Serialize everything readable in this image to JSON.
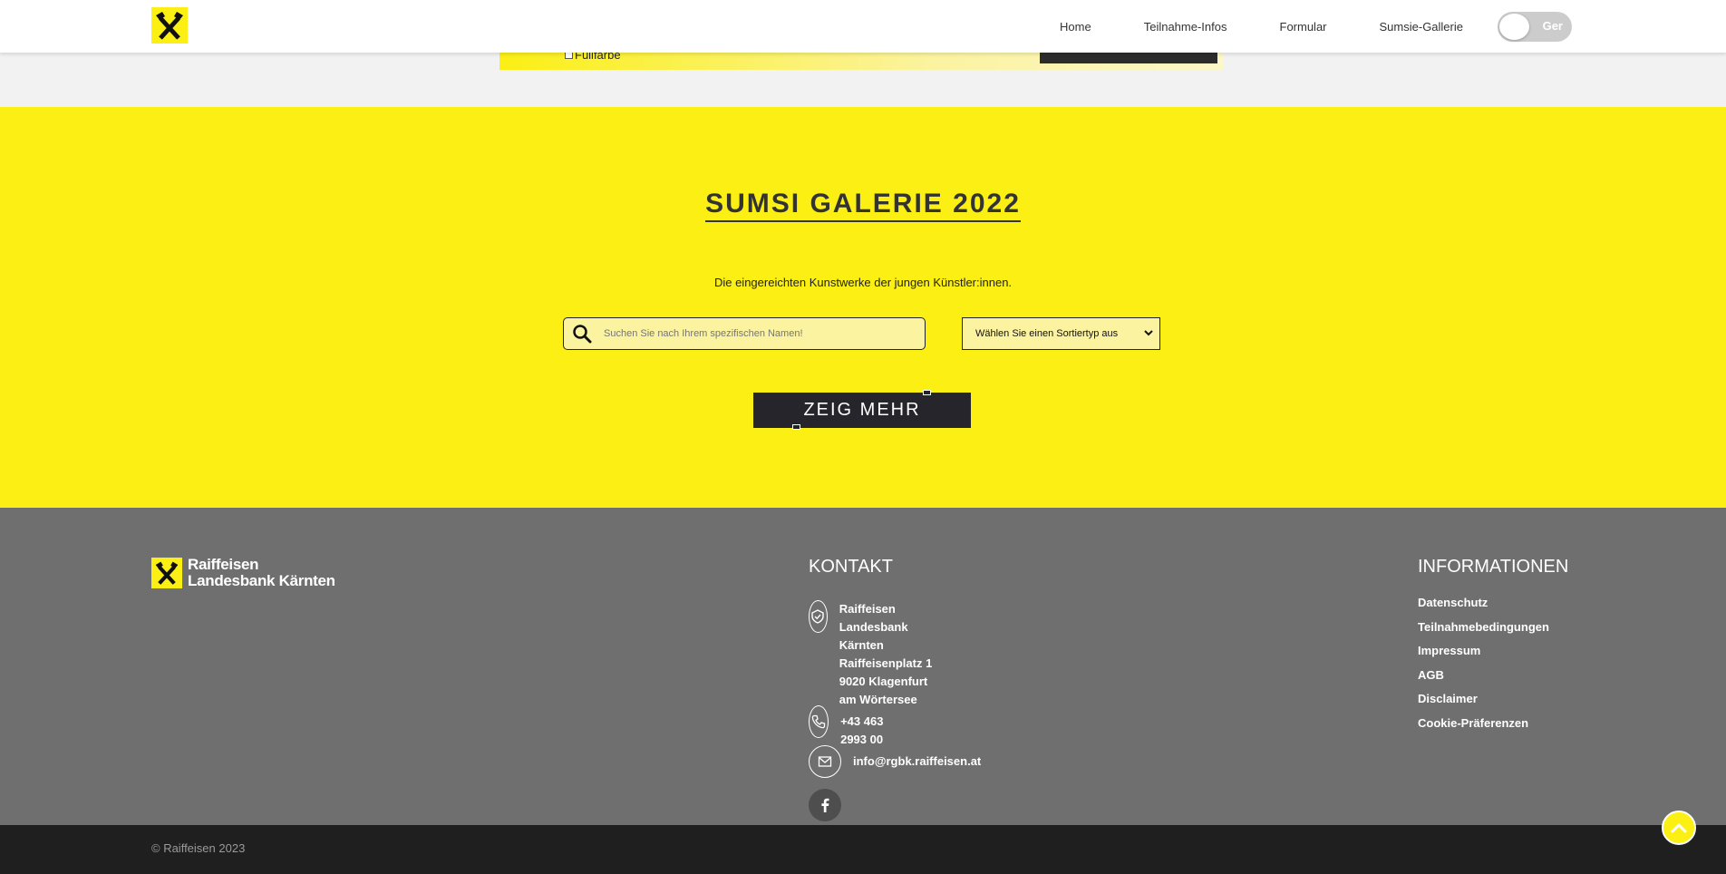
{
  "nav": {
    "items": [
      "Home",
      "Teilnahme-Infos",
      "Formular",
      "Sumsie-Gallerie"
    ],
    "language_toggle": "Ger"
  },
  "form_strip": {
    "checkbox_label": "Füllfarbe"
  },
  "gallery": {
    "title": "SUMSI GALERIE 2022",
    "subtitle": "Die eingereichten Kunstwerke der jungen Künstler:innen.",
    "search_placeholder": "Suchen Sie nach Ihrem spezifischen Namen!",
    "sort_selected": "Wählen Sie einen Sortiertyp aus",
    "more_button": "ZEIG MEHR"
  },
  "footer": {
    "logo_line1": "Raiffeisen",
    "logo_line2": "Landesbank Kärnten",
    "kontakt": {
      "title": "KONTAKT",
      "address_line1": "Raiffeisen Landesbank Kärnten",
      "address_line2": "Raiffeisenplatz 1",
      "address_line3": "9020 Klagenfurt am Wörtersee",
      "phone": "+43 463 2993 00",
      "email": "info@rgbk.raiffeisen.at"
    },
    "informationen": {
      "title": "INFORMATIONEN",
      "links": [
        "Datenschutz",
        "Teilnahmebedingungen",
        "Impressum",
        "AGB",
        "Disclaimer",
        "Cookie-Präferenzen"
      ]
    },
    "copyright": "© Raiffeisen 2023"
  },
  "colors": {
    "brand_yellow": "#fbef14",
    "footer_gray": "#6f6f6f",
    "bottom_bar": "#1f1f1f",
    "dark_button": "#25252b"
  }
}
